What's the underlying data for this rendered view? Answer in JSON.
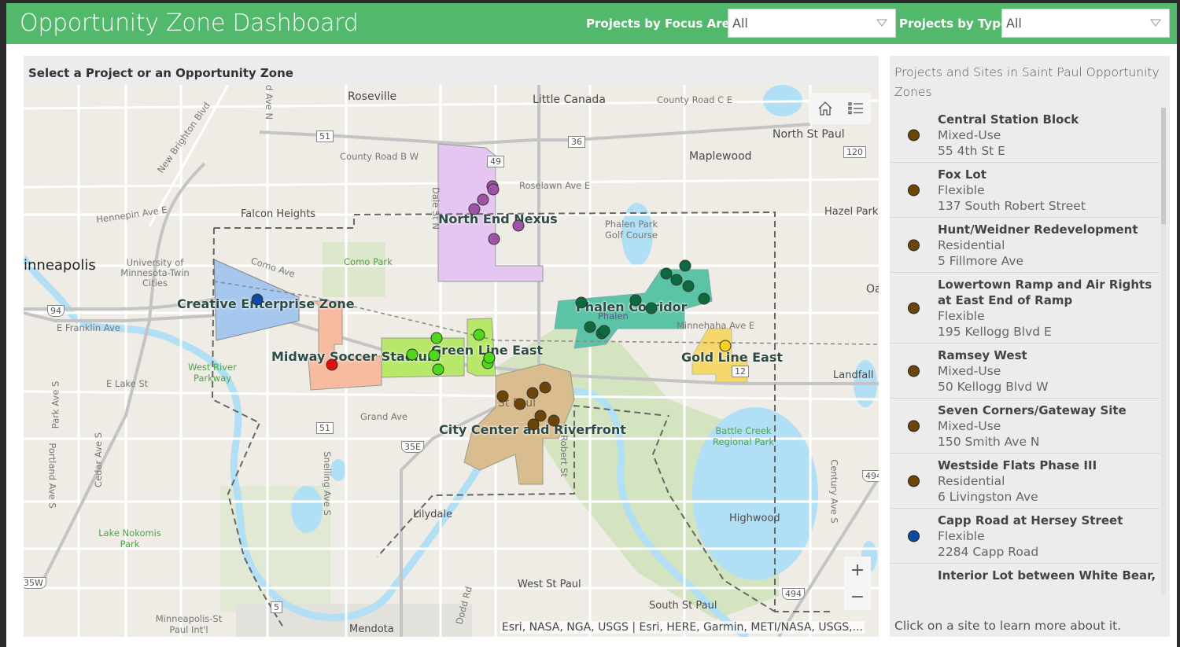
{
  "header": {
    "title": "Opportunity Zone Dashboard",
    "filters": [
      {
        "label": "Projects by Focus Area",
        "value": "All"
      },
      {
        "label": "Projects by Type",
        "value": "All"
      }
    ]
  },
  "map_panel": {
    "title": "Select a Project or an Opportunity Zone",
    "attribution": "Esri, NASA, NGA, USGS | Esri, HERE, Garmin, METI/NASA, USGS,...",
    "tools": {
      "home": "home-icon",
      "legend": "legend-list-icon",
      "zoom_in": "+",
      "zoom_out": "−"
    },
    "cities": [
      "Roseville",
      "Little Canada",
      "Maplewood",
      "North St Paul",
      "Falcon Heights",
      "Hazel Park",
      "inneapolis",
      "West St Paul",
      "South St Paul",
      "Mendota",
      "Lilydale",
      "Highwood",
      "Landfall",
      "St Paul",
      "Oa"
    ],
    "roads": [
      "New Brighton Blvd",
      "County Road C E",
      "County Road B W",
      "Roselawn Ave E",
      "Hennepin Ave E",
      "Como Ave",
      "E Franklin Ave",
      "E Lake St",
      "Grand Ave",
      "Minnehaha Ave E",
      "Dale St N",
      "Snelling Ave S",
      "Robert St",
      "Cedar Ave S",
      "Portland Ave S",
      "Park Ave S",
      "Dodd Rd",
      "Century Ave S",
      "d Ave N",
      "Phalen",
      "University of Minnesota-Twin Cities"
    ],
    "parks": [
      "Como Park",
      "Phalen Park Golf Course",
      "West River Parkway",
      "Battle Creek Regional Park",
      "Lake Nokomis Park",
      "Minneapolis-St Paul Int'l"
    ],
    "shields": [
      "51",
      "36",
      "49",
      "120",
      "94",
      "51",
      "35E",
      "12",
      "494",
      "494",
      "5",
      "35W"
    ],
    "zones": [
      {
        "name": "North End Nexus",
        "color": "#e5c6f0"
      },
      {
        "name": "Creative Enterprise Zone",
        "color": "#a6c8ee"
      },
      {
        "name": "Midway Soccer Stadium",
        "color": "#f7bca0"
      },
      {
        "name": "Green Line East",
        "color": "#b8e86a"
      },
      {
        "name": "Phalen Corridor",
        "color": "#5cc4a6"
      },
      {
        "name": "Gold Line East",
        "color": "#f6d86a"
      },
      {
        "name": "City Center and Riverfront",
        "color": "#d9bd8e"
      }
    ],
    "point_colors": {
      "north_end": "#a052a8",
      "creative": "#0a4aa0",
      "midway": "#e01010",
      "green_line": "#4ed81a",
      "phalen": "#0d6a3e",
      "gold_line": "#f5d020",
      "city_center": "#6b4406"
    }
  },
  "list_panel": {
    "title": "Projects and Sites in Saint Paul Opportunity Zones",
    "footer": "Click on a site to learn more about it.",
    "items": [
      {
        "name": "Central Station Block",
        "type": "Mixed-Use",
        "address": "55 4th St E",
        "color": "#6b4406"
      },
      {
        "name": "Fox Lot",
        "type": "Flexible",
        "address": "137 South Robert Street",
        "color": "#6b4406"
      },
      {
        "name": "Hunt/Weidner Redevelopment",
        "type": "Residential",
        "address": "5 Fillmore Ave",
        "color": "#6b4406"
      },
      {
        "name": "Lowertown Ramp and Air Rights at East End of Ramp",
        "type": "Flexible",
        "address": "195 Kellogg Blvd E",
        "color": "#6b4406"
      },
      {
        "name": "Ramsey West",
        "type": "Mixed-Use",
        "address": "50 Kellogg Blvd W",
        "color": "#6b4406"
      },
      {
        "name": "Seven Corners/Gateway Site",
        "type": "Mixed-Use",
        "address": "150 Smith Ave N",
        "color": "#6b4406"
      },
      {
        "name": "Westside Flats Phase III",
        "type": "Residential",
        "address": "6 Livingston Ave",
        "color": "#6b4406"
      },
      {
        "name": "Capp Road at Hersey Street",
        "type": "Flexible",
        "address": "2284 Capp Road",
        "color": "#0a4aa0"
      },
      {
        "name": "Interior Lot between White Bear,",
        "type": "",
        "address": "",
        "color": ""
      }
    ]
  }
}
